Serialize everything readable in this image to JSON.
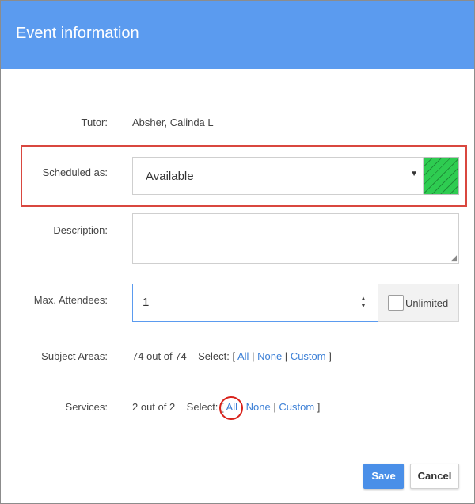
{
  "header": {
    "title": "Event information"
  },
  "tutor": {
    "label": "Tutor:",
    "value": "Absher, Calinda L"
  },
  "scheduled": {
    "label": "Scheduled as:",
    "value": "Available",
    "swatch_color": "#2ecc51"
  },
  "description": {
    "label": "Description:",
    "value": ""
  },
  "attendees": {
    "label": "Max. Attendees:",
    "value": "1",
    "unlimited_label": "Unlimited",
    "unlimited_checked": false
  },
  "subject_areas": {
    "label": "Subject Areas:",
    "count": "74 out of 74",
    "select_prefix": "Select: [",
    "all": "All",
    "none": "None",
    "custom": "Custom",
    "sep": "|",
    "close": "]"
  },
  "services": {
    "label": "Services:",
    "count": "2 out of 2",
    "select_prefix": "Select: [",
    "all": "All",
    "none": "None",
    "custom": "Custom",
    "sep": "|",
    "close": "]"
  },
  "buttons": {
    "save": "Save",
    "cancel": "Cancel"
  },
  "colors": {
    "header": "#5b9bef",
    "link": "#3b7fd6",
    "highlight": "#d9473f",
    "save": "#4a8fe8"
  }
}
